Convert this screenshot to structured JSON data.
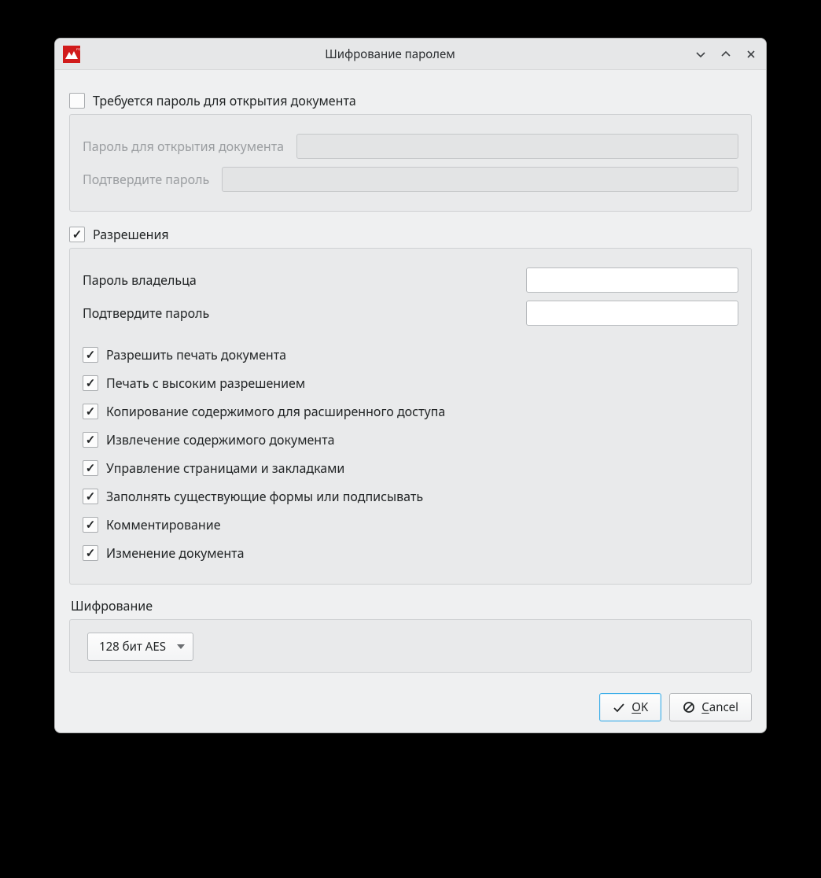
{
  "title": "Шифрование паролем",
  "require_open_password": {
    "checked": false,
    "label": "Требуется пароль для открытия документа"
  },
  "open_password": {
    "label": "Пароль для открытия документа",
    "value": ""
  },
  "open_password_confirm": {
    "label": "Подтвердите пароль",
    "value": ""
  },
  "permissions": {
    "checked": true,
    "label": "Разрешения",
    "owner_password": {
      "label": "Пароль владельца",
      "value": ""
    },
    "owner_password_confirm": {
      "label": "Подтвердите пароль",
      "value": ""
    },
    "items": [
      {
        "checked": true,
        "label": "Разрешить печать документа"
      },
      {
        "checked": true,
        "label": "Печать с высоким разрешением"
      },
      {
        "checked": true,
        "label": "Копирование содержимого для расширенного доступа"
      },
      {
        "checked": true,
        "label": "Извлечение содержимого документа"
      },
      {
        "checked": true,
        "label": "Управление страницами и закладками"
      },
      {
        "checked": true,
        "label": "Заполнять существующие формы или подписывать"
      },
      {
        "checked": true,
        "label": "Комментирование"
      },
      {
        "checked": true,
        "label": "Изменение документа"
      }
    ]
  },
  "encryption": {
    "label": "Шифрование",
    "selected": "128 бит AES"
  },
  "buttons": {
    "ok_prefix": "O",
    "ok_rest": "K",
    "cancel_prefix": "C",
    "cancel_rest": "ancel"
  }
}
